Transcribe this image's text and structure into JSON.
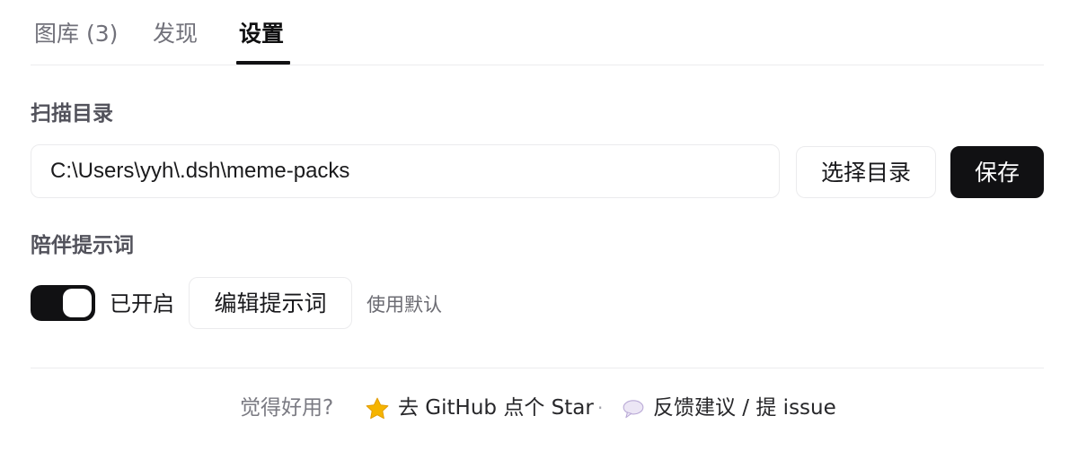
{
  "tabs": [
    {
      "label": "图库 (3)",
      "active": false
    },
    {
      "label": "发现",
      "active": false
    },
    {
      "label": "设置",
      "active": true
    }
  ],
  "scan": {
    "title": "扫描目录",
    "path_value": "C:\\Users\\yyh\\.dsh\\meme-packs",
    "choose_label": "选择目录",
    "save_label": "保存"
  },
  "prompt": {
    "title": "陪伴提示词",
    "toggle_on": true,
    "toggle_label": "已开启",
    "edit_label": "编辑提示词",
    "default_label": "使用默认"
  },
  "footer": {
    "prompt": "觉得好用?",
    "star_label": "去 GitHub 点个 Star",
    "separator": "·",
    "feedback_label": "反馈建议 / 提 issue",
    "icons": [
      "star-icon",
      "speech-bubble-icon"
    ]
  },
  "colors": {
    "accent_dark": "#111113",
    "muted_text": "#71717a",
    "border": "#ebebed",
    "star_yellow": "#f5b400"
  }
}
